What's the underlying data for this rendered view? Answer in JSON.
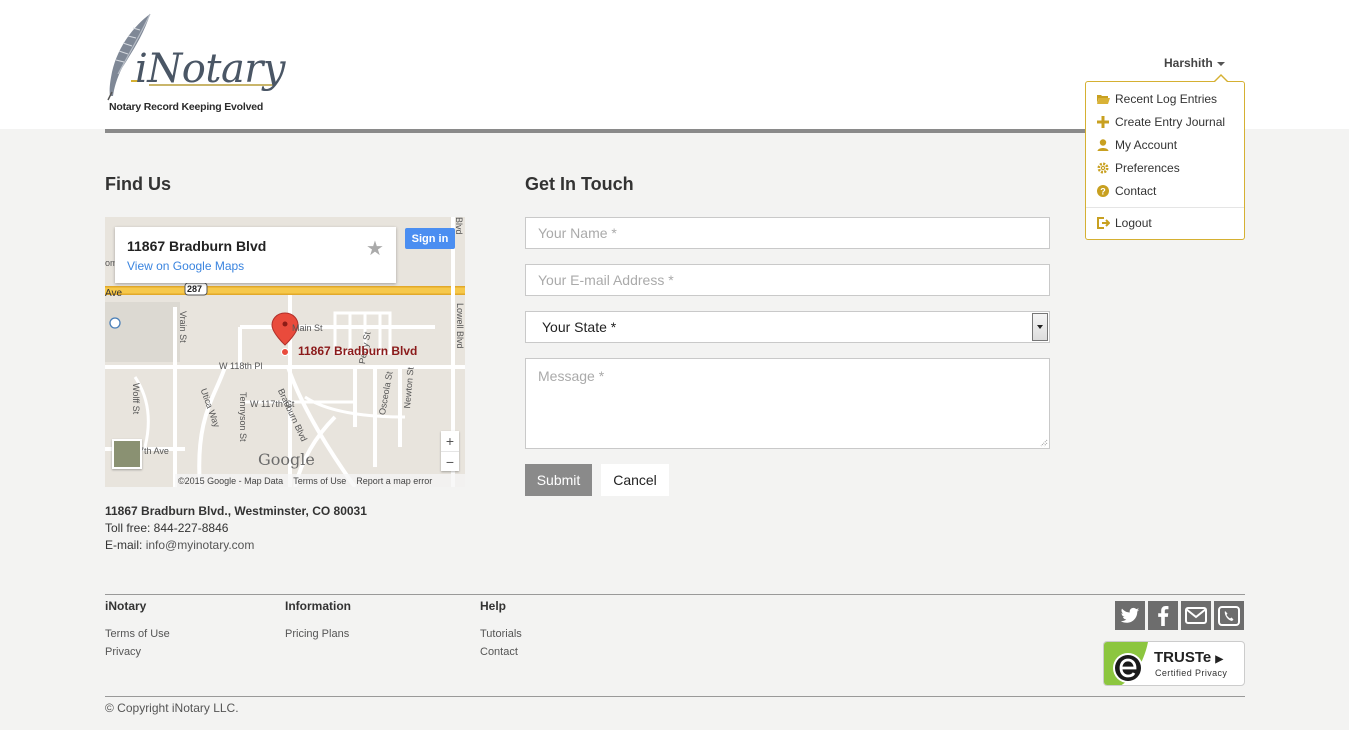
{
  "brand": {
    "name": "iNotary",
    "tagline": "Notary Record Keeping Evolved",
    "accent": "#d5b032"
  },
  "user_menu": {
    "username": "Harshith",
    "items": [
      {
        "label": "Recent Log Entries",
        "icon": "folder-open-icon"
      },
      {
        "label": "Create Entry Journal",
        "icon": "plus-icon"
      },
      {
        "label": "My Account",
        "icon": "user-icon"
      },
      {
        "label": "Preferences",
        "icon": "gear-icon"
      },
      {
        "label": "Contact",
        "icon": "question-icon"
      },
      {
        "label": "Logout",
        "icon": "logout-icon"
      }
    ]
  },
  "find_us": {
    "title": "Find Us",
    "map": {
      "card_title": "11867 Bradburn Blvd",
      "card_link": "View on Google Maps",
      "sign_in": "Sign in",
      "pin_label": "11867 Bradburn Blvd",
      "google": "Google",
      "footer": [
        "©2015 Google - Map Data",
        "Terms of Use",
        "Report a map error"
      ],
      "zoom_in": "+",
      "zoom_out": "−",
      "streets": [
        "Ave",
        "287",
        "Main St",
        "W 118th Pl",
        "Bradburn Blvd",
        "W 117th Ct",
        "Tennyson St",
        "Utica Way",
        "Wolff St",
        "Perry St",
        "Osceola St",
        "Newton St",
        "Lowell Blvd",
        "Vrain St",
        "7th Ave",
        "Blvd",
        "om"
      ]
    },
    "address": "11867 Bradburn Blvd., Westminster, CO 80031",
    "toll_free": "Toll free: 844-227-8846",
    "email_label": "E-mail:",
    "email": "info@myinotary.com"
  },
  "get_in_touch": {
    "title": "Get In Touch",
    "name_placeholder": "Your Name *",
    "email_placeholder": "Your E-mail Address *",
    "state_value": "Your State *",
    "message_placeholder": "Message *",
    "submit_label": "Submit",
    "cancel_label": "Cancel"
  },
  "footer": {
    "columns": [
      {
        "heading": "iNotary",
        "links": [
          "Terms of Use",
          "Privacy"
        ]
      },
      {
        "heading": "Information",
        "links": [
          "Pricing Plans"
        ]
      },
      {
        "heading": "Help",
        "links": [
          "Tutorials",
          "Contact"
        ]
      }
    ],
    "social": [
      "twitter-icon",
      "facebook-icon",
      "mail-icon",
      "phone-icon"
    ],
    "truste": {
      "name": "TRUSTe",
      "sub": "Certified Privacy"
    },
    "copyright": "© Copyright iNotary LLC."
  }
}
